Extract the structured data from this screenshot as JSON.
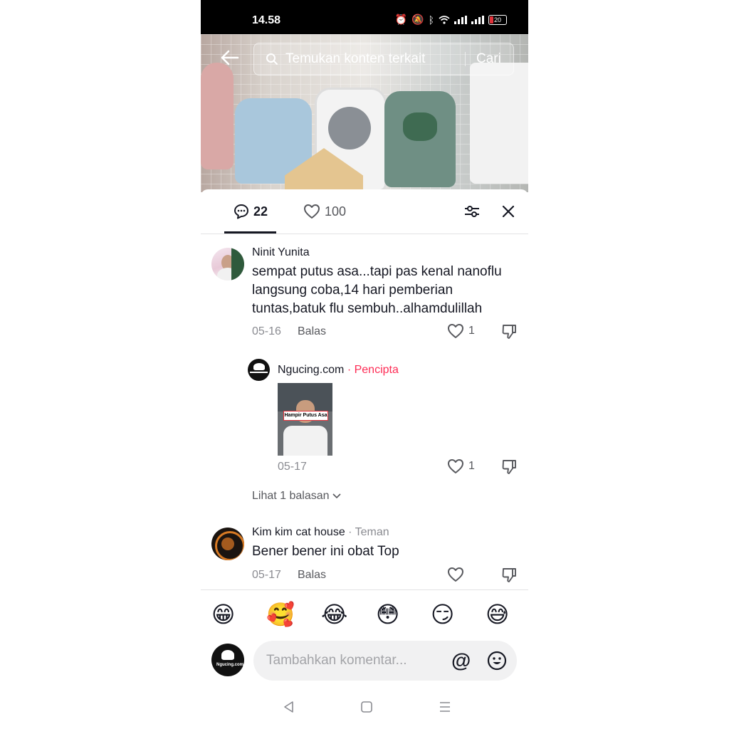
{
  "status_bar": {
    "time": "14.58",
    "battery": "20"
  },
  "search": {
    "placeholder": "Temukan konten terkait",
    "button": "Cari"
  },
  "tabs": {
    "comments_count": "22",
    "likes_count": "100"
  },
  "comments": [
    {
      "user": "Ninit Yunita",
      "lines": [
        "sempat putus asa...tapi pas kenal nanoflu",
        "langsung coba,14 hari pemberian",
        "tuntas,batuk flu sembuh..alhamdulillah"
      ],
      "date": "05-16",
      "reply_label": "Balas",
      "likes": "1"
    },
    {
      "user": "Ngucing.com",
      "badge": "· Pencipta",
      "thumb_caption": "Hampir Putus Asa",
      "avatar_text": "Ngucing.com",
      "date": "05-17",
      "likes": "1",
      "more_replies": "Lihat 1 balasan"
    },
    {
      "user": "Kim kim cat house",
      "tag": "· Teman",
      "text": "Bener bener ini obat Top",
      "date": "05-17",
      "reply_label": "Balas"
    }
  ],
  "emojis": [
    "😁",
    "🥰",
    "😂",
    "😳",
    "😏",
    "😅"
  ],
  "composer": {
    "placeholder": "Tambahkan komentar...",
    "mention": "@",
    "avatar_text": "Ngucing.com"
  },
  "colors": {
    "creator_badge": "#fe2c55",
    "text": "#161823",
    "muted": "#8a8b91"
  }
}
